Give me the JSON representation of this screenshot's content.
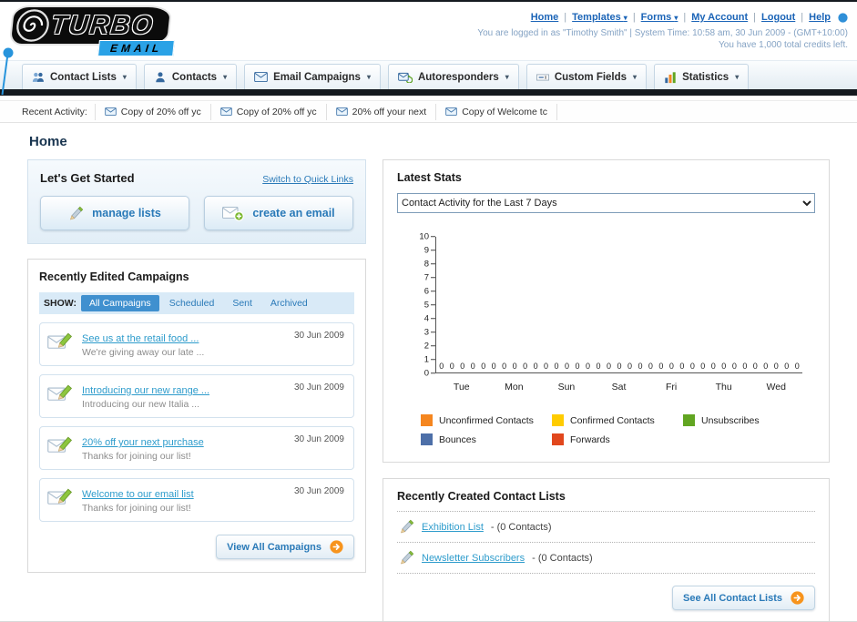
{
  "header": {
    "logo": {
      "title": "TURBO",
      "subtitle": "EMAIL"
    },
    "top_links": [
      {
        "label": "Home",
        "dropdown": false
      },
      {
        "label": "Templates",
        "dropdown": true
      },
      {
        "label": "Forms",
        "dropdown": true
      },
      {
        "label": "My Account",
        "dropdown": false
      },
      {
        "label": "Logout",
        "dropdown": false
      },
      {
        "label": "Help",
        "dropdown": false
      }
    ],
    "session_line": "You are logged in as \"Timothy Smith\" | System Time: 10:58 am, 30 Jun 2009 - (GMT+10:00)",
    "credits_line": "You have 1,000 total credits left."
  },
  "nav": {
    "tabs": [
      {
        "label": "Contact Lists",
        "icon": "contact-lists"
      },
      {
        "label": "Contacts",
        "icon": "contacts"
      },
      {
        "label": "Email Campaigns",
        "icon": "email-campaigns"
      },
      {
        "label": "Autoresponders",
        "icon": "autoresponders"
      },
      {
        "label": "Custom Fields",
        "icon": "custom-fields"
      },
      {
        "label": "Statistics",
        "icon": "statistics"
      }
    ]
  },
  "recent_activity": {
    "label": "Recent Activity:",
    "items": [
      {
        "label": "Copy of 20% off yc"
      },
      {
        "label": "Copy of 20% off yc"
      },
      {
        "label": "20% off your next"
      },
      {
        "label": "Copy of Welcome tc"
      }
    ]
  },
  "page_title": "Home",
  "get_started": {
    "title": "Let's Get Started",
    "switch_link": "Switch to Quick Links",
    "manage_lists_label": "manage lists",
    "create_email_label": "create an email"
  },
  "campaigns": {
    "title": "Recently Edited Campaigns",
    "show_label": "SHOW:",
    "filters": [
      {
        "label": "All Campaigns",
        "active": true
      },
      {
        "label": "Scheduled",
        "active": false
      },
      {
        "label": "Sent",
        "active": false
      },
      {
        "label": "Archived",
        "active": false
      }
    ],
    "items": [
      {
        "title": "See us at the retail food ...",
        "subtitle": "We're giving away our late ...",
        "date": "30 Jun 2009"
      },
      {
        "title": "Introducing our new range ...",
        "subtitle": "Introducing our new Italia ...",
        "date": "30 Jun 2009"
      },
      {
        "title": "20% off your next purchase",
        "subtitle": "Thanks for joining our list!",
        "date": "30 Jun 2009"
      },
      {
        "title": "Welcome to our email list",
        "subtitle": "Thanks for joining our list!",
        "date": "30 Jun 2009"
      }
    ],
    "view_all_label": "View All Campaigns"
  },
  "latest_stats": {
    "title": "Latest Stats",
    "selector_value": "Contact Activity for the Last 7 Days",
    "chart_data": {
      "type": "bar",
      "title": "Contact Activity for the Last 7 Days",
      "categories": [
        "Tue",
        "Mon",
        "Sun",
        "Sat",
        "Fri",
        "Thu",
        "Wed"
      ],
      "series": [
        {
          "name": "Unconfirmed Contacts",
          "color": "#F5861F",
          "values": [
            0,
            0,
            0,
            0,
            0,
            0,
            0
          ]
        },
        {
          "name": "Confirmed Contacts",
          "color": "#FFCC00",
          "values": [
            0,
            0,
            0,
            0,
            0,
            0,
            0
          ]
        },
        {
          "name": "Unsubscribes",
          "color": "#61A521",
          "values": [
            0,
            0,
            0,
            0,
            0,
            0,
            0
          ]
        },
        {
          "name": "Bounces",
          "color": "#4D6FA8",
          "values": [
            0,
            0,
            0,
            0,
            0,
            0,
            0
          ]
        },
        {
          "name": "Forwards",
          "color": "#E1471D",
          "values": [
            0,
            0,
            0,
            0,
            0,
            0,
            0
          ]
        }
      ],
      "ylim": [
        0,
        10
      ],
      "ytick_step": 1,
      "grid": false,
      "legend_position": "bottom",
      "value_labels_shown": true
    }
  },
  "contact_lists": {
    "title": "Recently Created Contact Lists",
    "items": [
      {
        "name": "Exhibition List",
        "detail": "- (0 Contacts)"
      },
      {
        "name": "Newsletter Subscribers",
        "detail": "- (0 Contacts)"
      }
    ],
    "see_all_label": "See All Contact Lists"
  }
}
